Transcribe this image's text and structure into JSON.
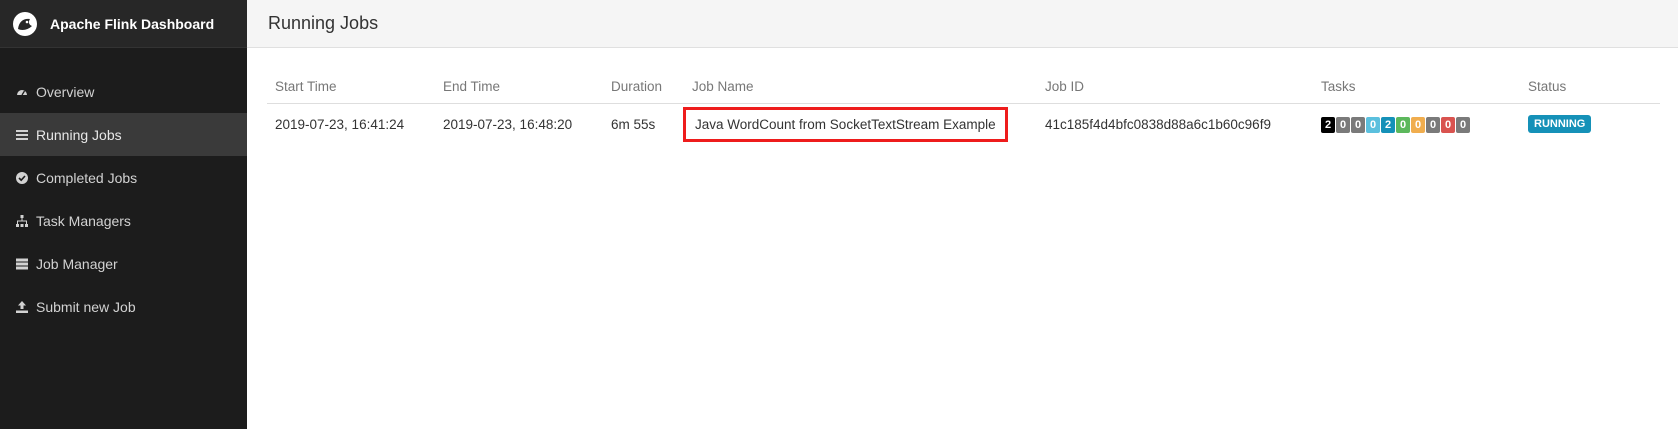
{
  "app": {
    "title": "Apache Flink Dashboard"
  },
  "sidebar": {
    "items": [
      {
        "label": "Overview",
        "icon": "dashboard-icon",
        "active": false
      },
      {
        "label": "Running Jobs",
        "icon": "list-icon",
        "active": true
      },
      {
        "label": "Completed Jobs",
        "icon": "check-circle-icon",
        "active": false
      },
      {
        "label": "Task Managers",
        "icon": "sitemap-icon",
        "active": false
      },
      {
        "label": "Job Manager",
        "icon": "server-icon",
        "active": false
      },
      {
        "label": "Submit new Job",
        "icon": "upload-icon",
        "active": false
      }
    ]
  },
  "page": {
    "title": "Running Jobs"
  },
  "table": {
    "columns": [
      "Start Time",
      "End Time",
      "Duration",
      "Job Name",
      "Job ID",
      "Tasks",
      "Status"
    ],
    "rows": [
      {
        "start_time": "2019-07-23, 16:41:24",
        "end_time": "2019-07-23, 16:48:20",
        "duration": "6m 55s",
        "job_name": "Java WordCount from SocketTextStream Example",
        "job_id": "41c185f4d4bfc0838d88a6c1b60c96f9",
        "tasks": [
          {
            "value": "2",
            "color": "#000000"
          },
          {
            "value": "0",
            "color": "#7a7a7a"
          },
          {
            "value": "0",
            "color": "#7a7a7a"
          },
          {
            "value": "0",
            "color": "#5bc0de"
          },
          {
            "value": "2",
            "color": "#1591b8"
          },
          {
            "value": "0",
            "color": "#5cb85c"
          },
          {
            "value": "0",
            "color": "#f0ad4e"
          },
          {
            "value": "0",
            "color": "#7a7a7a"
          },
          {
            "value": "0",
            "color": "#d9534f"
          },
          {
            "value": "0",
            "color": "#7a7a7a"
          }
        ],
        "status": "RUNNING"
      }
    ]
  },
  "colors": {
    "sidebar_bg": "#1c1c1c",
    "highlight_border": "#ee1c1c",
    "status_running": "#1591b8"
  }
}
